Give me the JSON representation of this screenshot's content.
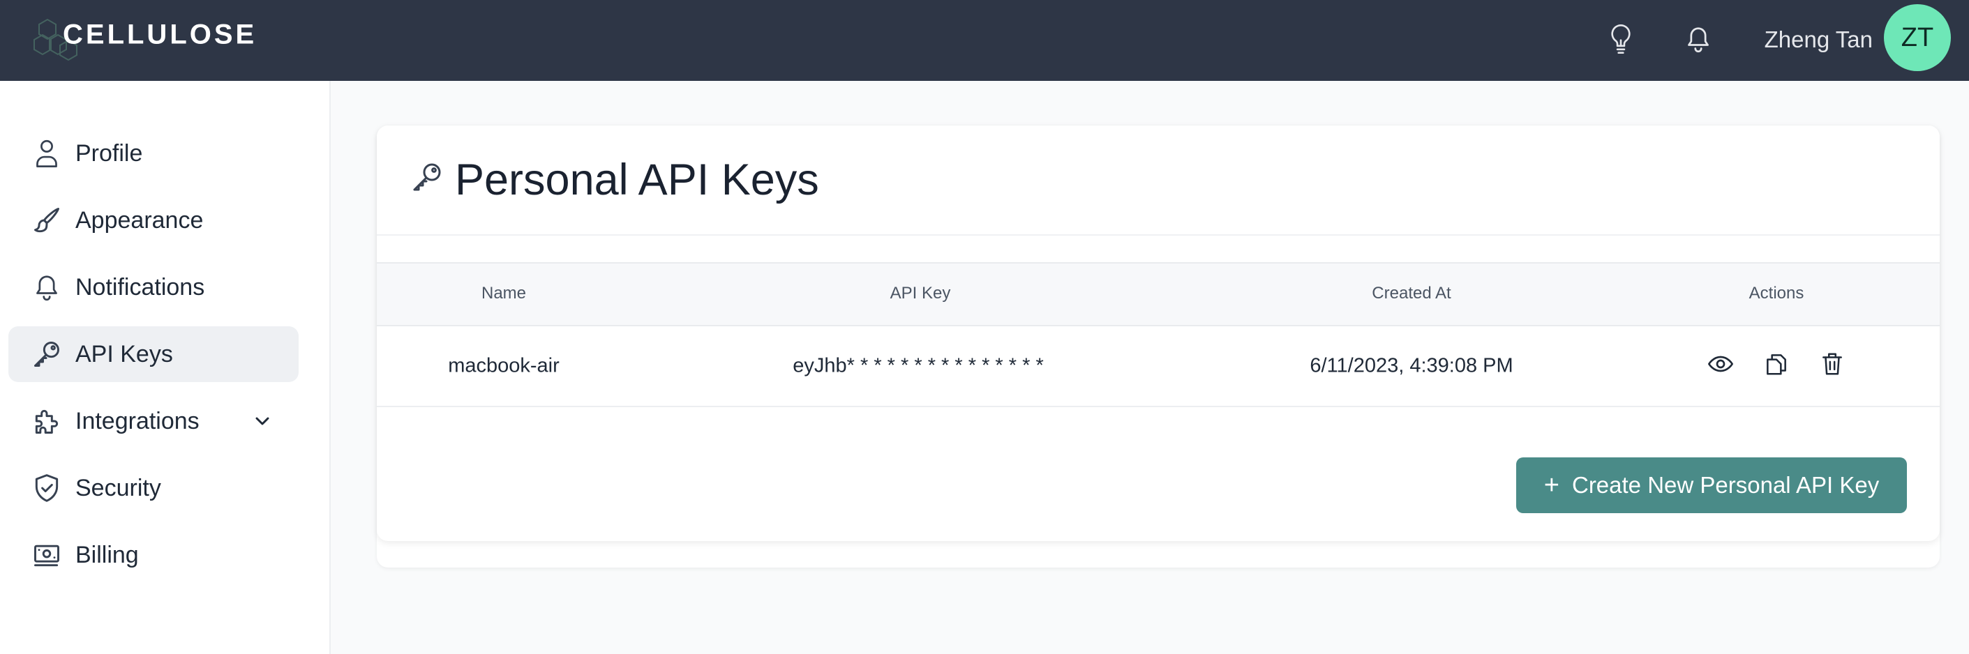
{
  "app": {
    "brand": "CELLULOSE"
  },
  "header": {
    "user_name": "Zheng Tan",
    "avatar_initials": "ZT",
    "avatar_color": "#6ee7b7",
    "icons": [
      "lightbulb-icon",
      "bell-icon"
    ]
  },
  "sidebar": {
    "items": [
      {
        "label": "Profile",
        "icon": "user-icon"
      },
      {
        "label": "Appearance",
        "icon": "brush-icon"
      },
      {
        "label": "Notifications",
        "icon": "bell-icon"
      },
      {
        "label": "API Keys",
        "icon": "key-icon",
        "active": true
      },
      {
        "label": "Integrations",
        "icon": "puzzle-icon",
        "expandable": true
      },
      {
        "label": "Security",
        "icon": "shield-check-icon"
      },
      {
        "label": "Billing",
        "icon": "money-icon"
      }
    ]
  },
  "main": {
    "title": "Personal API Keys",
    "table": {
      "columns": [
        "Name",
        "API Key",
        "Created At",
        "Actions"
      ],
      "rows": [
        {
          "name": "macbook-air",
          "api_key": "eyJhb* * * * * * * * * * * * * * *",
          "created_at": "6/11/2023, 4:39:08 PM",
          "actions": [
            "eye-icon",
            "copy-icon",
            "trash-icon"
          ]
        }
      ]
    },
    "create_button": {
      "label": "Create New Personal API Key",
      "icon": "plus-icon"
    },
    "accent_color": "#4a8b88"
  }
}
